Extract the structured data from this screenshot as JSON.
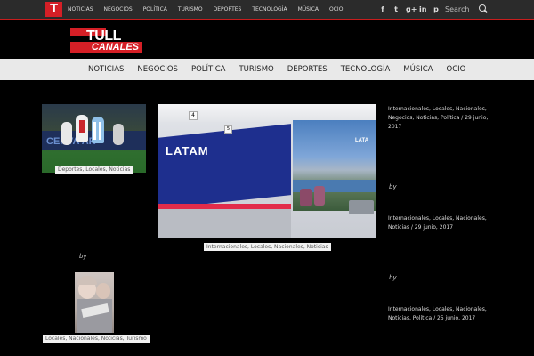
{
  "top_nav": [
    "NOTICIAS",
    "NEGOCIOS",
    "POLÍTICA",
    "TURISMO",
    "DEPORTES",
    "TECNOLOGÍA",
    "MÚSICA",
    "OCIO"
  ],
  "logo_letter": "T",
  "social_icons": [
    "f",
    "t",
    "g+",
    "in",
    "p"
  ],
  "search_label": "Search",
  "brand": {
    "line1": "TULL",
    "line2": "CANALES"
  },
  "main_nav": [
    "NOTICIAS",
    "NEGOCIOS",
    "POLÍTICA",
    "TURISMO",
    "DEPORTES",
    "TECNOLOGÍA",
    "MÚSICA",
    "OCIO"
  ],
  "posts": {
    "p1_caption": "Deportes, Locales, Noticias",
    "p2_caption": "Internacionales, Locales, Nacionales, Noticias",
    "p2_brand": "LATAM",
    "p3_caption": "Locales, Nacionales, Noticias, Turismo",
    "meta1": "Internacionales, Locales, Nacionales, Negocios, Noticias, Política  /  29 junio, 2017",
    "meta2": "Internacionales, Locales, Nacionales, Noticias  /  29 junio, 2017",
    "meta3": "Internacionales, Locales, Nacionales, Noticias, Política  /  25 junio, 2017",
    "by": "by"
  }
}
